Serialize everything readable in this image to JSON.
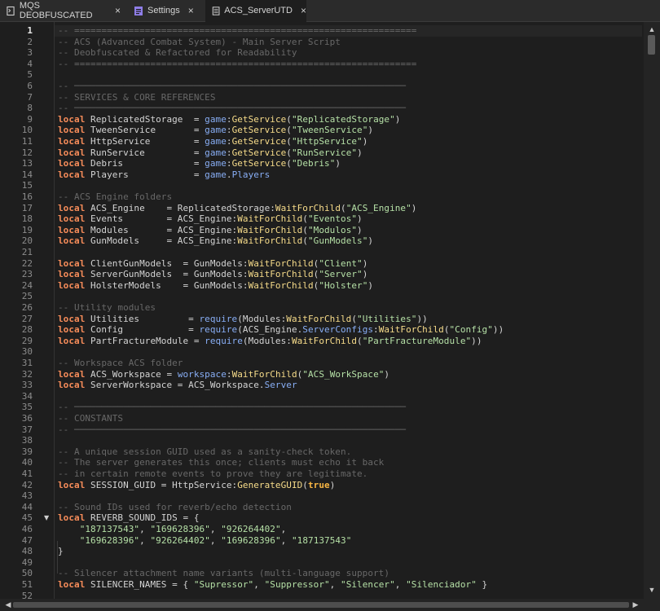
{
  "tabs": [
    {
      "label": "MQS DEOBFUSCATED",
      "icon": "script-icon",
      "active": false
    },
    {
      "label": "Settings",
      "icon": "settings-doc-icon",
      "active": false
    },
    {
      "label": "ACS_ServerUTD",
      "icon": "document-icon",
      "active": true
    }
  ],
  "editor": {
    "current_line": 1,
    "folded_lines": [
      45
    ],
    "lines": [
      [
        [
          "cm",
          "-- ==============================================================="
        ]
      ],
      [
        [
          "cm",
          "-- ACS (Advanced Combat System) - Main Server Script"
        ]
      ],
      [
        [
          "cm",
          "-- Deobfuscated & Refactored for Readability"
        ]
      ],
      [
        [
          "cm",
          "-- ==============================================================="
        ]
      ],
      [],
      [
        [
          "cm",
          "-- ─────────────────────────────────────────────────────────────"
        ]
      ],
      [
        [
          "cm",
          "-- SERVICES & CORE REFERENCES"
        ]
      ],
      [
        [
          "cm",
          "-- ─────────────────────────────────────────────────────────────"
        ]
      ],
      [
        [
          "kw",
          "local"
        ],
        [
          "id",
          " ReplicatedStorage  = "
        ],
        [
          "glb",
          "game"
        ],
        [
          "op",
          ":"
        ],
        [
          "fn",
          "GetService"
        ],
        [
          "op",
          "("
        ],
        [
          "str",
          "\"ReplicatedStorage\""
        ],
        [
          "op",
          ")"
        ]
      ],
      [
        [
          "kw",
          "local"
        ],
        [
          "id",
          " TweenService       = "
        ],
        [
          "glb",
          "game"
        ],
        [
          "op",
          ":"
        ],
        [
          "fn",
          "GetService"
        ],
        [
          "op",
          "("
        ],
        [
          "str",
          "\"TweenService\""
        ],
        [
          "op",
          ")"
        ]
      ],
      [
        [
          "kw",
          "local"
        ],
        [
          "id",
          " HttpService        = "
        ],
        [
          "glb",
          "game"
        ],
        [
          "op",
          ":"
        ],
        [
          "fn",
          "GetService"
        ],
        [
          "op",
          "("
        ],
        [
          "str",
          "\"HttpService\""
        ],
        [
          "op",
          ")"
        ]
      ],
      [
        [
          "kw",
          "local"
        ],
        [
          "id",
          " RunService         = "
        ],
        [
          "glb",
          "game"
        ],
        [
          "op",
          ":"
        ],
        [
          "fn",
          "GetService"
        ],
        [
          "op",
          "("
        ],
        [
          "str",
          "\"RunService\""
        ],
        [
          "op",
          ")"
        ]
      ],
      [
        [
          "kw",
          "local"
        ],
        [
          "id",
          " Debris             = "
        ],
        [
          "glb",
          "game"
        ],
        [
          "op",
          ":"
        ],
        [
          "fn",
          "GetService"
        ],
        [
          "op",
          "("
        ],
        [
          "str",
          "\"Debris\""
        ],
        [
          "op",
          ")"
        ]
      ],
      [
        [
          "kw",
          "local"
        ],
        [
          "id",
          " Players            = "
        ],
        [
          "glb",
          "game"
        ],
        [
          "op",
          "."
        ],
        [
          "glb",
          "Players"
        ]
      ],
      [],
      [
        [
          "cm",
          "-- ACS Engine folders"
        ]
      ],
      [
        [
          "kw",
          "local"
        ],
        [
          "id",
          " ACS_Engine    = ReplicatedStorage:"
        ],
        [
          "fn",
          "WaitForChild"
        ],
        [
          "op",
          "("
        ],
        [
          "str",
          "\"ACS_Engine\""
        ],
        [
          "op",
          ")"
        ]
      ],
      [
        [
          "kw",
          "local"
        ],
        [
          "id",
          " Events        = ACS_Engine:"
        ],
        [
          "fn",
          "WaitForChild"
        ],
        [
          "op",
          "("
        ],
        [
          "str",
          "\"Eventos\""
        ],
        [
          "op",
          ")"
        ]
      ],
      [
        [
          "kw",
          "local"
        ],
        [
          "id",
          " Modules       = ACS_Engine:"
        ],
        [
          "fn",
          "WaitForChild"
        ],
        [
          "op",
          "("
        ],
        [
          "str",
          "\"Modulos\""
        ],
        [
          "op",
          ")"
        ]
      ],
      [
        [
          "kw",
          "local"
        ],
        [
          "id",
          " GunModels     = ACS_Engine:"
        ],
        [
          "fn",
          "WaitForChild"
        ],
        [
          "op",
          "("
        ],
        [
          "str",
          "\"GunModels\""
        ],
        [
          "op",
          ")"
        ]
      ],
      [],
      [
        [
          "kw",
          "local"
        ],
        [
          "id",
          " ClientGunModels  = GunModels:"
        ],
        [
          "fn",
          "WaitForChild"
        ],
        [
          "op",
          "("
        ],
        [
          "str",
          "\"Client\""
        ],
        [
          "op",
          ")"
        ]
      ],
      [
        [
          "kw",
          "local"
        ],
        [
          "id",
          " ServerGunModels  = GunModels:"
        ],
        [
          "fn",
          "WaitForChild"
        ],
        [
          "op",
          "("
        ],
        [
          "str",
          "\"Server\""
        ],
        [
          "op",
          ")"
        ]
      ],
      [
        [
          "kw",
          "local"
        ],
        [
          "id",
          " HolsterModels    = GunModels:"
        ],
        [
          "fn",
          "WaitForChild"
        ],
        [
          "op",
          "("
        ],
        [
          "str",
          "\"Holster\""
        ],
        [
          "op",
          ")"
        ]
      ],
      [],
      [
        [
          "cm",
          "-- Utility modules"
        ]
      ],
      [
        [
          "kw",
          "local"
        ],
        [
          "id",
          " Utilities         = "
        ],
        [
          "glb",
          "require"
        ],
        [
          "op",
          "(Modules:"
        ],
        [
          "fn",
          "WaitForChild"
        ],
        [
          "op",
          "("
        ],
        [
          "str",
          "\"Utilities\""
        ],
        [
          "op",
          "))"
        ]
      ],
      [
        [
          "kw",
          "local"
        ],
        [
          "id",
          " Config            = "
        ],
        [
          "glb",
          "require"
        ],
        [
          "op",
          "(ACS_Engine."
        ],
        [
          "glb",
          "ServerConfigs"
        ],
        [
          "op",
          ":"
        ],
        [
          "fn",
          "WaitForChild"
        ],
        [
          "op",
          "("
        ],
        [
          "str",
          "\"Config\""
        ],
        [
          "op",
          "))"
        ]
      ],
      [
        [
          "kw",
          "local"
        ],
        [
          "id",
          " PartFractureModule = "
        ],
        [
          "glb",
          "require"
        ],
        [
          "op",
          "(Modules:"
        ],
        [
          "fn",
          "WaitForChild"
        ],
        [
          "op",
          "("
        ],
        [
          "str",
          "\"PartFractureModule\""
        ],
        [
          "op",
          "))"
        ]
      ],
      [],
      [
        [
          "cm",
          "-- Workspace ACS folder"
        ]
      ],
      [
        [
          "kw",
          "local"
        ],
        [
          "id",
          " ACS_Workspace = "
        ],
        [
          "glb",
          "workspace"
        ],
        [
          "op",
          ":"
        ],
        [
          "fn",
          "WaitForChild"
        ],
        [
          "op",
          "("
        ],
        [
          "str",
          "\"ACS_WorkSpace\""
        ],
        [
          "op",
          ")"
        ]
      ],
      [
        [
          "kw",
          "local"
        ],
        [
          "id",
          " ServerWorkspace = ACS_Workspace."
        ],
        [
          "glb",
          "Server"
        ]
      ],
      [],
      [
        [
          "cm",
          "-- ─────────────────────────────────────────────────────────────"
        ]
      ],
      [
        [
          "cm",
          "-- CONSTANTS"
        ]
      ],
      [
        [
          "cm",
          "-- ─────────────────────────────────────────────────────────────"
        ]
      ],
      [],
      [
        [
          "cm",
          "-- A unique session GUID used as a sanity-check token."
        ]
      ],
      [
        [
          "cm",
          "-- The server generates this once; clients must echo it back"
        ]
      ],
      [
        [
          "cm",
          "-- in certain remote events to prove they are legitimate."
        ]
      ],
      [
        [
          "kw",
          "local"
        ],
        [
          "id",
          " SESSION_GUID = HttpService:"
        ],
        [
          "fn",
          "GenerateGUID"
        ],
        [
          "op",
          "("
        ],
        [
          "bool",
          "true"
        ],
        [
          "op",
          ")"
        ]
      ],
      [],
      [
        [
          "cm",
          "-- Sound IDs used for reverb/echo detection"
        ]
      ],
      [
        [
          "kw",
          "local"
        ],
        [
          "id",
          " REVERB_SOUND_IDS = {"
        ]
      ],
      [
        [
          "id",
          "    "
        ],
        [
          "str",
          "\"187137543\""
        ],
        [
          "op",
          ", "
        ],
        [
          "str",
          "\"169628396\""
        ],
        [
          "op",
          ", "
        ],
        [
          "str",
          "\"926264402\""
        ],
        [
          "op",
          ","
        ]
      ],
      [
        [
          "id",
          "    "
        ],
        [
          "str",
          "\"169628396\""
        ],
        [
          "op",
          ", "
        ],
        [
          "str",
          "\"926264402\""
        ],
        [
          "op",
          ", "
        ],
        [
          "str",
          "\"169628396\""
        ],
        [
          "op",
          ", "
        ],
        [
          "str",
          "\"187137543\""
        ]
      ],
      [
        [
          "op",
          "}"
        ]
      ],
      [],
      [
        [
          "cm",
          "-- Silencer attachment name variants (multi-language support)"
        ]
      ],
      [
        [
          "kw",
          "local"
        ],
        [
          "id",
          " SILENCER_NAMES = { "
        ],
        [
          "str",
          "\"Supressor\""
        ],
        [
          "op",
          ", "
        ],
        [
          "str",
          "\"Suppressor\""
        ],
        [
          "op",
          ", "
        ],
        [
          "str",
          "\"Silencer\""
        ],
        [
          "op",
          ", "
        ],
        [
          "str",
          "\"Silenciador\""
        ],
        [
          "op",
          " }"
        ]
      ],
      []
    ]
  },
  "colors": {
    "keyword": "#f88d5a",
    "comment": "#686868",
    "string": "#b5e0a6",
    "global": "#88aef5",
    "function": "#f7dc8a",
    "boolean": "#f7b543",
    "background": "#1e1e1e"
  }
}
